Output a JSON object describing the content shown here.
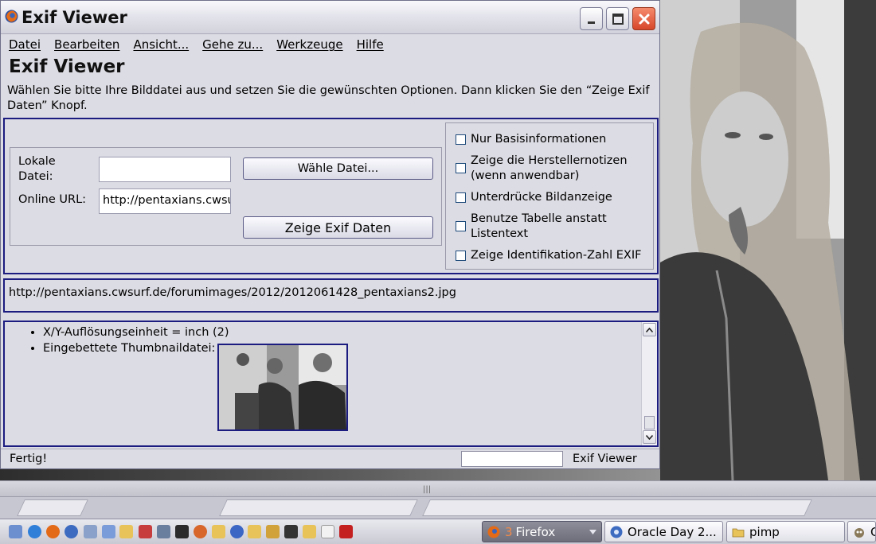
{
  "window": {
    "title": "Exif Viewer"
  },
  "menu": [
    "Datei",
    "Bearbeiten",
    "Ansicht...",
    "Gehe zu...",
    "Werkzeuge",
    "Hilfe"
  ],
  "page": {
    "heading": "Exif Viewer",
    "intro": "Wählen Sie bitte Ihre Bilddatei aus und setzen Sie die gewünschten Optionen. Dann klicken Sie den “Zeige Exif Daten” Knopf."
  },
  "form": {
    "local_file_label": "Lokale Datei:",
    "local_file_value": "",
    "online_url_label": "Online URL:",
    "online_url_value": "http://pentaxians.cwsurf.de/forumimages/2012/2012061428_pentaxians2.jpg",
    "choose_file_button": "Wähle Datei...",
    "show_exif_button": "Zeige Exif Daten"
  },
  "options": [
    {
      "label": "Nur Basisinformationen",
      "checked": false
    },
    {
      "label": "Zeige die Herstellernotizen (wenn anwendbar)",
      "checked": false
    },
    {
      "label": "Unterdrücke Bildanzeige",
      "checked": false
    },
    {
      "label": "Benutze Tabelle anstatt Listentext",
      "checked": false
    },
    {
      "label": "Zeige Identifikation-Zahl EXIF",
      "checked": false
    }
  ],
  "current_url": "http://pentaxians.cwsurf.de/forumimages/2012/2012061428_pentaxians2.jpg",
  "results": [
    "X/Y-Auflösungseinheit = inch (2)",
    "Eingebettete Thumbnaildatei:"
  ],
  "status": {
    "text": "Fertig!",
    "app_label": "Exif Viewer"
  },
  "taskbar": {
    "tasks": [
      {
        "count": "3",
        "label": "Firefox",
        "active": true
      },
      {
        "label": "Oracle Day 2...",
        "active": false
      },
      {
        "label": "pimp",
        "active": false
      },
      {
        "label": "G",
        "active": false
      }
    ]
  },
  "colors": {
    "window_bg": "#dcdce4",
    "frame_border": "#1c1c80",
    "close_button": "#d7472a"
  }
}
